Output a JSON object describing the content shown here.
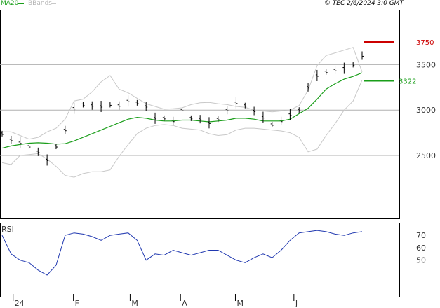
{
  "header": {
    "ma_label": "MA20",
    "bbands_label": "BBands",
    "info": "© TEC 2/6/2024 3:0 GMT"
  },
  "colors": {
    "ma": "#1a9e1a",
    "bbands": "#c8c8c8",
    "price": "#000000",
    "rsi": "#2038b0",
    "resistance": "#cc0000",
    "support": "#1a9e1a",
    "grid": "#aaaaaa"
  },
  "chart_data": [
    {
      "type": "line",
      "subtype": "ohlc-bars",
      "title": "",
      "xlabel": "",
      "ylabel": "",
      "x_ticks": [
        "24",
        "F",
        "M",
        "A",
        "M",
        "J"
      ],
      "y_ticks": [
        2500,
        3000,
        3500
      ],
      "ylim": [
        2200,
        3800
      ],
      "grid": true,
      "series": [
        {
          "name": "MA20",
          "values": [
            2580,
            2605,
            2620,
            2635,
            2640,
            2635,
            2625,
            2630,
            2660,
            2700,
            2740,
            2780,
            2820,
            2860,
            2900,
            2920,
            2910,
            2890,
            2880,
            2880,
            2890,
            2890,
            2880,
            2870,
            2880,
            2890,
            2910,
            2910,
            2900,
            2880,
            2880,
            2880,
            2900,
            2960,
            3020,
            3120,
            3230,
            3290,
            3340,
            3370,
            3410
          ]
        },
        {
          "name": "BBands",
          "upper": [
            2760,
            2760,
            2720,
            2680,
            2700,
            2760,
            2800,
            2900,
            3100,
            3120,
            3200,
            3310,
            3380,
            3230,
            3190,
            3130,
            3070,
            3040,
            3010,
            3015,
            3025,
            3060,
            3080,
            3085,
            3070,
            3060,
            3040,
            3030,
            3000,
            2990,
            2980,
            2990,
            3000,
            3050,
            3220,
            3490,
            3600,
            3630,
            3660,
            3690,
            3420
          ],
          "lower": [
            2420,
            2400,
            2500,
            2510,
            2520,
            2460,
            2380,
            2280,
            2260,
            2300,
            2320,
            2320,
            2340,
            2490,
            2620,
            2740,
            2800,
            2830,
            2840,
            2830,
            2800,
            2790,
            2780,
            2740,
            2720,
            2730,
            2780,
            2800,
            2800,
            2790,
            2780,
            2770,
            2750,
            2700,
            2540,
            2570,
            2720,
            2850,
            3000,
            3100,
            3330
          ]
        },
        {
          "name": "Price",
          "values": [
            2740,
            2670,
            2640,
            2600,
            2540,
            2450,
            2600,
            2780,
            3020,
            3060,
            3050,
            3040,
            3060,
            3050,
            3100,
            3080,
            3040,
            2910,
            2910,
            2880,
            3000,
            2910,
            2900,
            2860,
            2900,
            3000,
            3080,
            3050,
            2990,
            2920,
            2840,
            2880,
            2950,
            3000,
            3250,
            3380,
            3420,
            3440,
            3460,
            3500,
            3600
          ]
        }
      ],
      "levels": [
        {
          "label": "3750",
          "value": 3750,
          "color": "#cc0000"
        },
        {
          "label": "3322",
          "value": 3322,
          "color": "#1a9e1a"
        }
      ]
    },
    {
      "type": "line",
      "title": "",
      "xlabel": "",
      "ylabel": "",
      "panel_label": "RSI",
      "y_ticks": [
        50,
        60,
        70
      ],
      "ylim": [
        30,
        85
      ],
      "grid": false,
      "series": [
        {
          "name": "RSI",
          "values": [
            70,
            55,
            50,
            48,
            42,
            38,
            46,
            70,
            72,
            71,
            69,
            66,
            70,
            71,
            72,
            66,
            50,
            55,
            54,
            58,
            56,
            54,
            56,
            58,
            58,
            54,
            50,
            48,
            52,
            55,
            52,
            58,
            66,
            72,
            73,
            74,
            73,
            71,
            70,
            72,
            73
          ]
        }
      ]
    }
  ]
}
